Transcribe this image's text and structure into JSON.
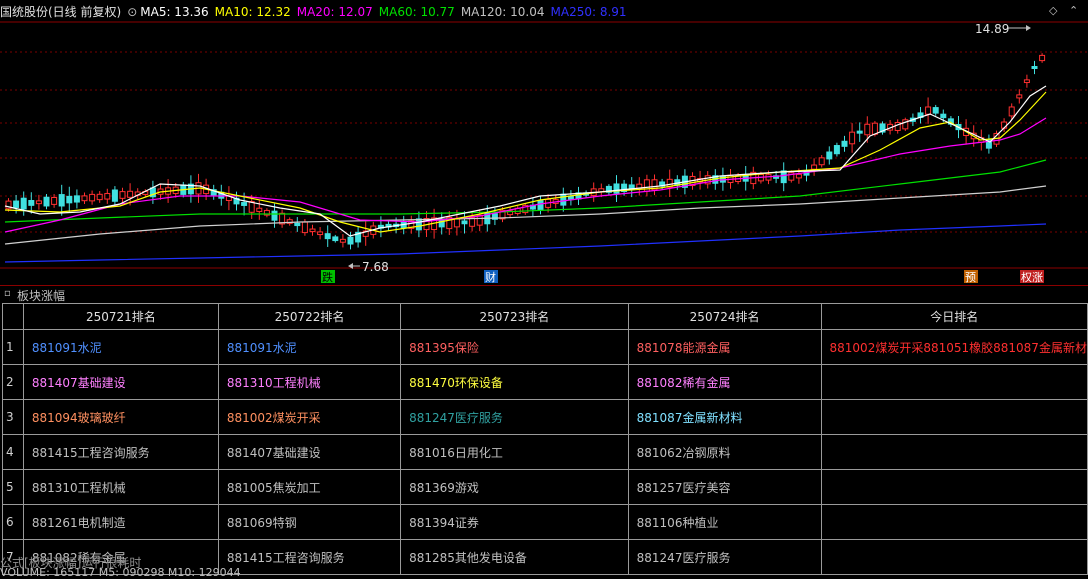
{
  "header": {
    "title": "国统股份(日线 前复权)",
    "ma": [
      {
        "label": "MA5: 13.36",
        "color": "#ffffff"
      },
      {
        "label": "MA10: 12.32",
        "color": "#ffff00"
      },
      {
        "label": "MA20: 12.07",
        "color": "#ff00ff"
      },
      {
        "label": "MA60: 10.77",
        "color": "#00e000"
      },
      {
        "label": "MA120: 10.04",
        "color": "#c0c0c0"
      },
      {
        "label": "MA250: 8.91",
        "color": "#3030ff"
      }
    ]
  },
  "chart_annotations": {
    "high_label": "14.89",
    "low_label": "7.68",
    "tags": [
      {
        "text": "跌",
        "color": "#00c000",
        "fg": "#000"
      },
      {
        "text": "财",
        "color": "#1060c0",
        "fg": "#fff"
      },
      {
        "text": "预",
        "color": "#c06000",
        "fg": "#fff"
      },
      {
        "text": "权涨",
        "color": "#c02020",
        "fg": "#fff"
      }
    ]
  },
  "panel": {
    "title": "板块涨幅",
    "headers": [
      "250721排名",
      "250722排名",
      "250723排名",
      "250724排名",
      "今日排名"
    ],
    "rows": [
      {
        "idx": "1",
        "cells": [
          {
            "text": "881091水泥",
            "color": "#5090ff"
          },
          {
            "text": "881091水泥",
            "color": "#5090ff"
          },
          {
            "text": "881395保险",
            "color": "#ff6060"
          },
          {
            "text": "881078能源金属",
            "color": "#ff6060"
          },
          {
            "text": "881002煤炭开采881051橡胶881087金属新材",
            "color": "#ff3030"
          }
        ]
      },
      {
        "idx": "2",
        "cells": [
          {
            "text": "881407基础建设",
            "color": "#ff80ff"
          },
          {
            "text": "881310工程机械",
            "color": "#ff80ff"
          },
          {
            "text": "881470环保设备",
            "color": "#ffff40"
          },
          {
            "text": "881082稀有金属",
            "color": "#ff80ff"
          },
          {
            "text": "",
            "color": "#c0c0c0"
          }
        ]
      },
      {
        "idx": "3",
        "cells": [
          {
            "text": "881094玻璃玻纤",
            "color": "#ff9060"
          },
          {
            "text": "881002煤炭开采",
            "color": "#ff9060"
          },
          {
            "text": "881247医疗服务",
            "color": "#30a0a0"
          },
          {
            "text": "881087金属新材料",
            "color": "#80e0ff"
          },
          {
            "text": "",
            "color": "#c0c0c0"
          }
        ]
      },
      {
        "idx": "4",
        "cells": [
          {
            "text": "881415工程咨询服务",
            "color": "#c0c0c0"
          },
          {
            "text": "881407基础建设",
            "color": "#c0c0c0"
          },
          {
            "text": "881016日用化工",
            "color": "#c0c0c0"
          },
          {
            "text": "881062冶钢原料",
            "color": "#c0c0c0"
          },
          {
            "text": "",
            "color": "#c0c0c0"
          }
        ]
      },
      {
        "idx": "5",
        "cells": [
          {
            "text": "881310工程机械",
            "color": "#c0c0c0"
          },
          {
            "text": "881005焦炭加工",
            "color": "#c0c0c0"
          },
          {
            "text": "881369游戏",
            "color": "#c0c0c0"
          },
          {
            "text": "881257医疗美容",
            "color": "#c0c0c0"
          },
          {
            "text": "",
            "color": "#c0c0c0"
          }
        ]
      },
      {
        "idx": "6",
        "cells": [
          {
            "text": "881261电机制造",
            "color": "#c0c0c0"
          },
          {
            "text": "881069特钢",
            "color": "#c0c0c0"
          },
          {
            "text": "881394证券",
            "color": "#c0c0c0"
          },
          {
            "text": "881106种植业",
            "color": "#c0c0c0"
          },
          {
            "text": "",
            "color": "#c0c0c0"
          }
        ]
      },
      {
        "idx": "7",
        "cells": [
          {
            "text": "881082稀有金属",
            "color": "#c0c0c0"
          },
          {
            "text": "881415工程咨询服务",
            "color": "#c0c0c0"
          },
          {
            "text": "881285其他发电设备",
            "color": "#c0c0c0"
          },
          {
            "text": "881247医疗服务",
            "color": "#c0c0c0"
          },
          {
            "text": "",
            "color": "#c0c0c0"
          }
        ]
      }
    ]
  },
  "footer": {
    "overlay": "公式[板块涨幅]运行很耗时",
    "status": "VOLUME: 165117  M5: 090298  M10: 129044"
  }
}
